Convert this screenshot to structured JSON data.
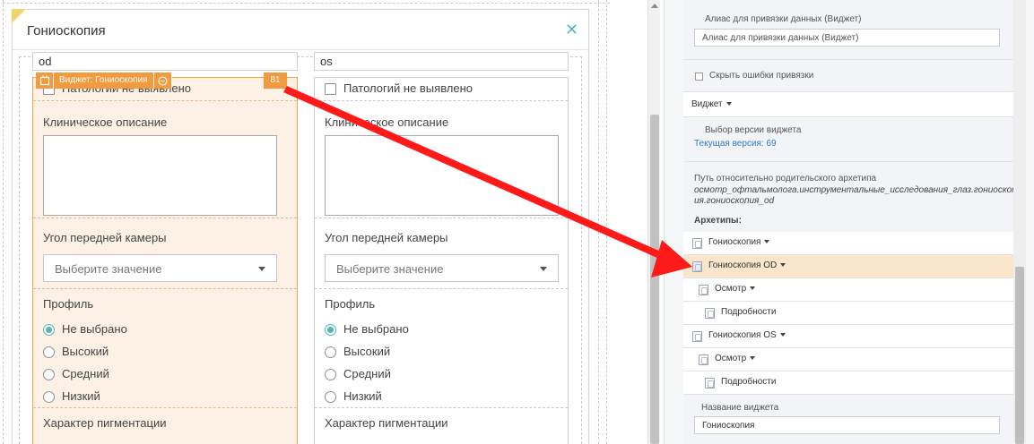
{
  "designer": {
    "form_title": "Гониоскопия",
    "columns": [
      {
        "key": "od",
        "name": "od",
        "no_pathology": "Патологий не выявлено",
        "clinical_description": "Клиническое описание",
        "angle_label": "Угол передней камеры",
        "angle_placeholder": "Выберите значение",
        "profile_label": "Профиль",
        "profile_options": [
          "Не выбрано",
          "Высокий",
          "Средний",
          "Низкий"
        ],
        "pigmentation_label": "Характер пигментации"
      },
      {
        "key": "os",
        "name": "os",
        "no_pathology": "Патологий не выявлено",
        "clinical_description": "Клиническое описание",
        "angle_label": "Угол передней камеры",
        "angle_placeholder": "Выберите значение",
        "profile_label": "Профиль",
        "profile_options": [
          "Не выбрано",
          "Высокий",
          "Средний",
          "Низкий"
        ],
        "pigmentation_label": "Характер пигментации"
      }
    ],
    "widget_toolbar": {
      "label": "Виджет: Гониоскопия",
      "badge": "81"
    }
  },
  "properties": {
    "alias_label": "Алиас для привязки данных (Виджет)",
    "alias_placeholder": "Алиас для привязки данных (Виджет)",
    "hide_errors_label": "Скрыть ошибки привязки",
    "widget_dropdown": "Виджет",
    "version_label": "Выбор версии виджета",
    "current_version": "Текущая версия: 69",
    "path_label": "Путь относительно родительского архетипа",
    "path_value_line1": "осмотр_офтальмолога.инструментальные_исследования_глаз.гониоскоп",
    "path_value_line2": "ия.гониоскопия_od",
    "archetypes_label": "Архетипы:",
    "archetypes": [
      {
        "label": "Гониоскопия",
        "dropdown": true
      },
      {
        "label": "Гониоскопия OD",
        "dropdown": true,
        "highlighted": true
      },
      {
        "label": "Осмотр",
        "dropdown": true
      },
      {
        "label": "Подробности",
        "dropdown": false
      },
      {
        "label": "Гониоскопия OS",
        "dropdown": true
      },
      {
        "label": "Осмотр",
        "dropdown": true
      },
      {
        "label": "Подробности",
        "dropdown": false
      }
    ],
    "widget_name_label": "Название виджета",
    "widget_name_value": "Гониоскопия"
  },
  "colors": {
    "accent_orange": "#f19a3e",
    "selection_bg": "#fdf1e6",
    "radio_teal": "#54b5b3",
    "link_blue": "#2d79c7",
    "annotation_red": "#ff1a1a"
  }
}
